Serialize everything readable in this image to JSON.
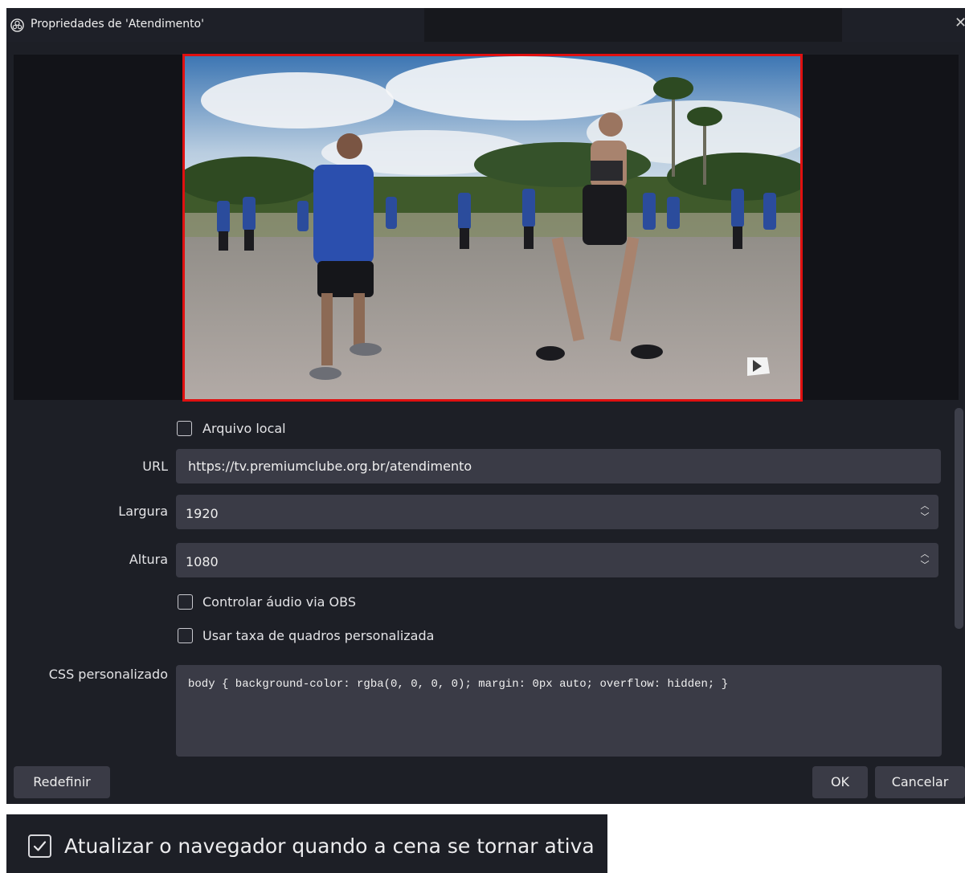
{
  "window": {
    "title": "Propriedades de 'Atendimento'",
    "close_symbol": "✕"
  },
  "icons": {
    "app": "obs-logo-icon",
    "close": "close-icon",
    "spinner_up": "chevron-up-icon",
    "spinner_down": "chevron-down-icon",
    "checkbox_checked": "check-icon"
  },
  "form": {
    "local_file": {
      "label": "Arquivo local",
      "checked": false
    },
    "url": {
      "label": "URL",
      "value": "https://tv.premiumclube.org.br/atendimento"
    },
    "width": {
      "label": "Largura",
      "value": "1920"
    },
    "height": {
      "label": "Altura",
      "value": "1080"
    },
    "control_audio": {
      "label": "Controlar áudio via OBS",
      "checked": false
    },
    "custom_fps": {
      "label": "Usar taxa de quadros personalizada",
      "checked": false
    },
    "custom_css": {
      "label": "CSS personalizado",
      "value": "body { background-color: rgba(0, 0, 0, 0); margin: 0px auto; overflow: hidden; }"
    }
  },
  "buttons": {
    "reset": "Redefinir",
    "ok": "OK",
    "cancel": "Cancelar"
  },
  "refresh_option": {
    "label": "Atualizar o navegador quando a cena se tornar ativa",
    "checked": true
  },
  "colors": {
    "window_bg": "#1d1f26",
    "field_bg": "#3a3b46",
    "preview_border": "#e01010"
  }
}
